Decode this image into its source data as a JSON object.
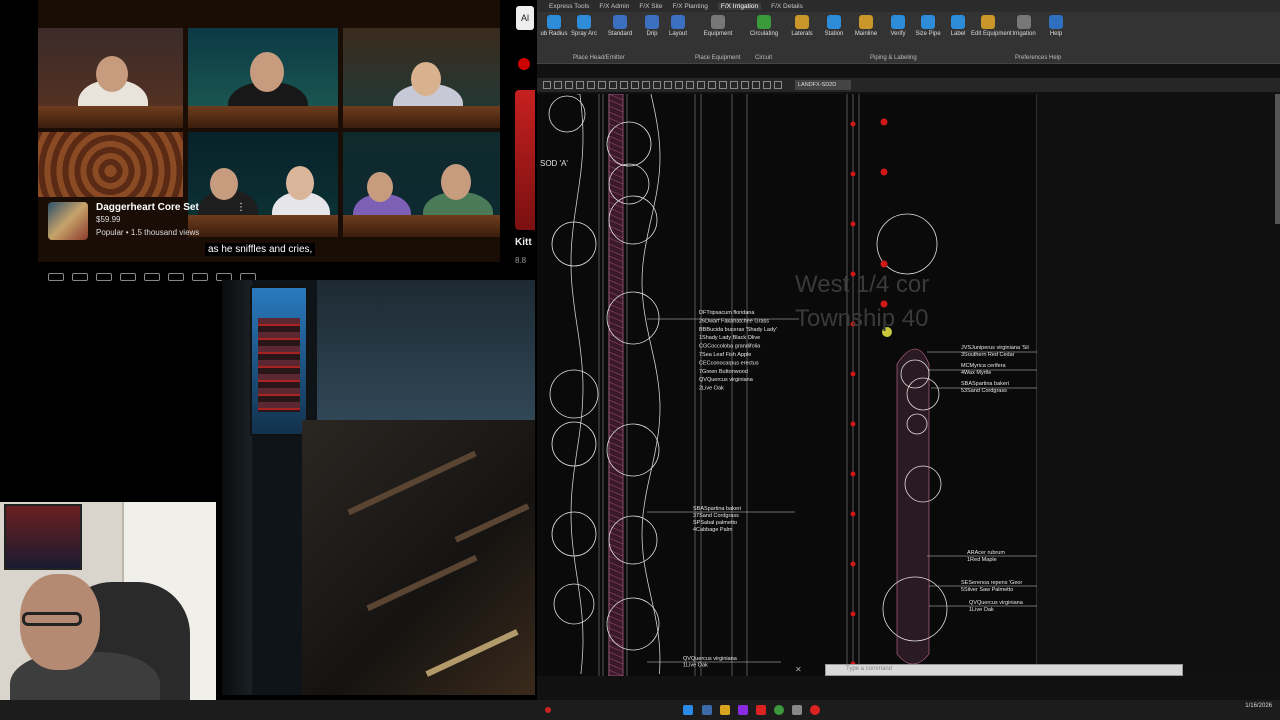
{
  "video": {
    "product_title": "Daggerheart Core Set",
    "product_price": "$59.99",
    "product_stats": "Popular • 1.5 thousand views",
    "caption": "as he sniffles and cries,",
    "more_icon": "⋮"
  },
  "side_panel": {
    "top_card_text": "Al",
    "kitty_label": "Kitt",
    "kitty_sub": "8.8"
  },
  "cad": {
    "tabs": [
      "Express Tools",
      "F/X Admin",
      "F/X Site",
      "F/X Planting",
      "F/X Irrigation",
      "F/X Details"
    ],
    "active_tab": "F/X Irrigation",
    "ribbon_buttons": [
      {
        "label": "ub Radius",
        "icon": "spray-radius-icon",
        "color": "#2e8bd8"
      },
      {
        "label": "Spray Arc",
        "icon": "spray-arc-icon",
        "color": "#2e8bd8"
      },
      {
        "label": "Standard",
        "icon": "standard-icon",
        "color": "#3b6fbf"
      },
      {
        "label": "Drip",
        "icon": "drip-icon",
        "color": "#3b6fbf"
      },
      {
        "label": "Layout",
        "icon": "layout-icon",
        "color": "#3b6fbf"
      },
      {
        "label": "Equipment",
        "icon": "equipment-icon",
        "color": "#777"
      },
      {
        "label": "Circulating",
        "icon": "circulating-icon",
        "color": "#3a9a3a"
      },
      {
        "label": "Laterals",
        "icon": "laterals-icon",
        "color": "#c9962a"
      },
      {
        "label": "Station",
        "icon": "station-icon",
        "color": "#2e8bd8"
      },
      {
        "label": "Mainline",
        "icon": "mainline-icon",
        "color": "#c9962a"
      },
      {
        "label": "Verify",
        "icon": "verify-icon",
        "color": "#2e8bd8"
      },
      {
        "label": "Size Pipe",
        "icon": "size-pipe-icon",
        "color": "#2e8bd8"
      },
      {
        "label": "Label",
        "icon": "label-icon",
        "color": "#2e8bd8"
      },
      {
        "label": "Edit Equipment",
        "icon": "edit-equipment-icon",
        "color": "#c9962a"
      },
      {
        "label": "Irrigation",
        "icon": "irrigation-prefs-icon",
        "color": "#777"
      },
      {
        "label": "Help",
        "icon": "help-icon",
        "color": "#2e6fbf"
      }
    ],
    "group_labels": [
      "Place Head/Emitter",
      "Place Equipment",
      "Circuit",
      "Piping & Labeling",
      "Preferences",
      "Help"
    ],
    "layer_combo": "LANDFX-SD2D",
    "command_placeholder": "Type a command",
    "drawing_labels": {
      "sod": "SOD 'A'",
      "watermark_line1": "West 1/4 cor",
      "watermark_line2": "Township 40",
      "left_callouts": [
        "DFTripsacum floridana",
        "26Dwarf Fakahatchee Grass",
        "BBBucida buceras 'Shady Lady'",
        "1Shady Lady Black Olive",
        "CGCoccoloba grandifolia",
        "7Sea Leaf Fish Apple",
        "CECconocarpus erectus",
        "7Green Buttonwood",
        "QVQuercus virginiana",
        "2Live Oak"
      ],
      "mid_callouts": [
        "SBASpartina bakeri",
        "37Sand Cordgrass",
        "SPSabal palmetto",
        "4Cabbage Palm"
      ],
      "bottom_callout": [
        "QVQuercus virginiana",
        "1Live Oak"
      ],
      "right_callouts": [
        "JVSJuniperus virginiana 'Sil",
        "3Southern Red Cedar",
        "MCMyrica cerifera",
        "4Wax Myrtle",
        "SBASpartina bakeri",
        "53Sand Cordgrass",
        "ARAcer rubrum",
        "1Red Maple",
        "SESerenoa repens 'Geor",
        "5Silver Saw Palmetto",
        "QVQuercus virginiana",
        "1Live Oak"
      ]
    }
  },
  "taskbar": {
    "date": "1/16/2026"
  }
}
